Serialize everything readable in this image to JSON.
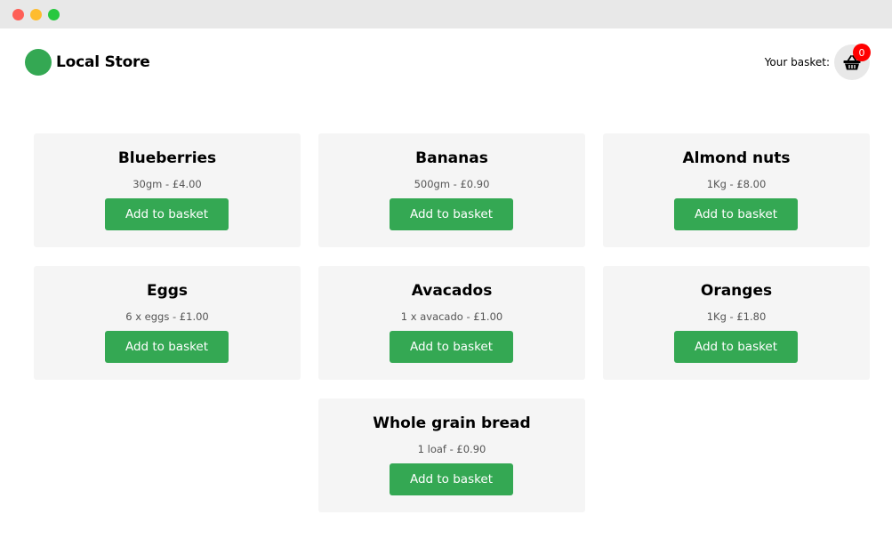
{
  "store": {
    "name": "Local Store",
    "brand_color": "#34a853"
  },
  "basket": {
    "label": "Your basket:",
    "count": "0",
    "icon": "basket-icon"
  },
  "products": [
    {
      "name": "Blueberries",
      "meta": "30gm - £4.00",
      "button": "Add to basket"
    },
    {
      "name": "Bananas",
      "meta": "500gm - £0.90",
      "button": "Add to basket"
    },
    {
      "name": "Almond nuts",
      "meta": "1Kg - £8.00",
      "button": "Add to basket"
    },
    {
      "name": "Eggs",
      "meta": "6 x eggs - £1.00",
      "button": "Add to basket"
    },
    {
      "name": "Avacados",
      "meta": "1 x avacado - £1.00",
      "button": "Add to basket"
    },
    {
      "name": "Oranges",
      "meta": "1Kg - £1.80",
      "button": "Add to basket"
    },
    {
      "name": "Whole grain bread",
      "meta": "1 loaf - £0.90",
      "button": "Add to basket"
    }
  ]
}
